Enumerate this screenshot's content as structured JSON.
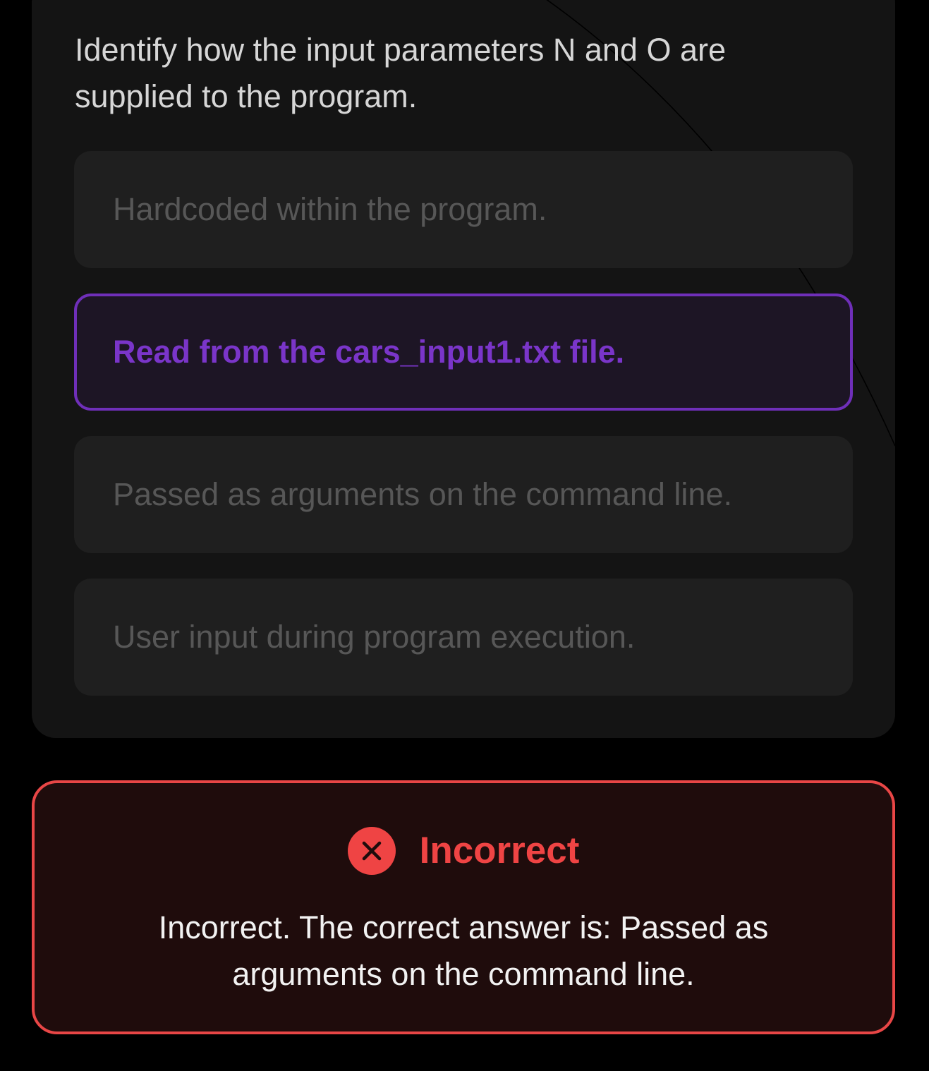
{
  "question": {
    "text": "Identify how the input parameters N and O are supplied to the program."
  },
  "options": [
    {
      "label": "Hardcoded within the program.",
      "selected": false
    },
    {
      "label": "Read from the cars_input1.txt file.",
      "selected": true
    },
    {
      "label": "Passed as arguments on the command line.",
      "selected": false
    },
    {
      "label": "User input during program execution.",
      "selected": false
    }
  ],
  "feedback": {
    "icon": "close-circle-icon",
    "title": "Incorrect",
    "message": "Incorrect. The correct answer is: Passed as arguments on the command line."
  },
  "colors": {
    "background": "#000000",
    "card": "#141414",
    "option": "#1f1f1f",
    "selected_accent": "#7a35c9",
    "error": "#ef4444"
  }
}
